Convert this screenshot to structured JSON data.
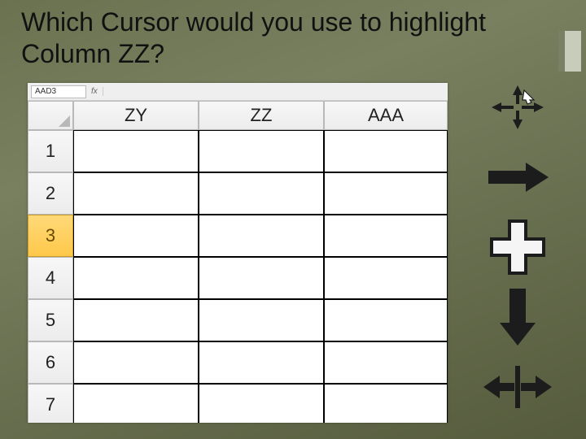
{
  "slide": {
    "title": "Which Cursor would you use to highlight Column ZZ?"
  },
  "spreadsheet": {
    "namebox_value": "AAD3",
    "fx_label": "fx",
    "columns": [
      "ZY",
      "ZZ",
      "AAA"
    ],
    "rows": [
      "1",
      "2",
      "3",
      "4",
      "5",
      "6",
      "7"
    ],
    "selected_row_index": 2
  },
  "cursor_options": [
    {
      "id": "move-arrows",
      "label": "Move (four-headed-arrow) cursor"
    },
    {
      "id": "fill-right-arrow",
      "label": "Fill / right black arrow cursor"
    },
    {
      "id": "precision-cross",
      "label": "White plus / cell-select cursor"
    },
    {
      "id": "down-arrow",
      "label": "Column-select down black arrow cursor"
    },
    {
      "id": "resize-horizontal",
      "label": "Column-resize horizontal double arrow cursor"
    }
  ]
}
